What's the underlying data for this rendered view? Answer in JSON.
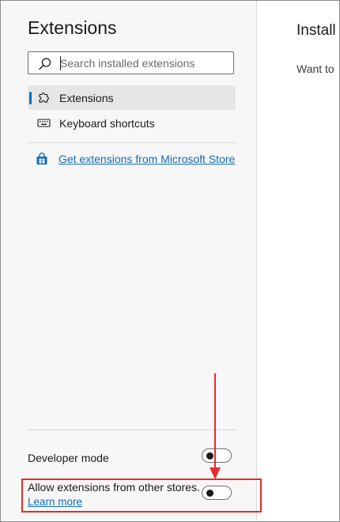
{
  "sidebar": {
    "title": "Extensions",
    "search": {
      "placeholder": "Search installed extensions",
      "value": ""
    },
    "nav": [
      {
        "label": "Extensions",
        "icon": "puzzle-icon",
        "active": true
      },
      {
        "label": "Keyboard shortcuts",
        "icon": "keyboard-icon",
        "active": false
      }
    ],
    "store_link": {
      "label": "Get extensions from Microsoft Store",
      "icon": "store-bag-icon"
    },
    "settings": {
      "developer_mode": {
        "label": "Developer mode",
        "enabled": false
      },
      "other_stores": {
        "label": "Allow extensions from other stores.",
        "link": "Learn more",
        "enabled": false
      }
    }
  },
  "main": {
    "title": "Install",
    "text": "Want to"
  },
  "colors": {
    "accent": "#0f6cbd",
    "annotation": "#e62b2b",
    "sidebar_bg": "#f7f7f7"
  }
}
